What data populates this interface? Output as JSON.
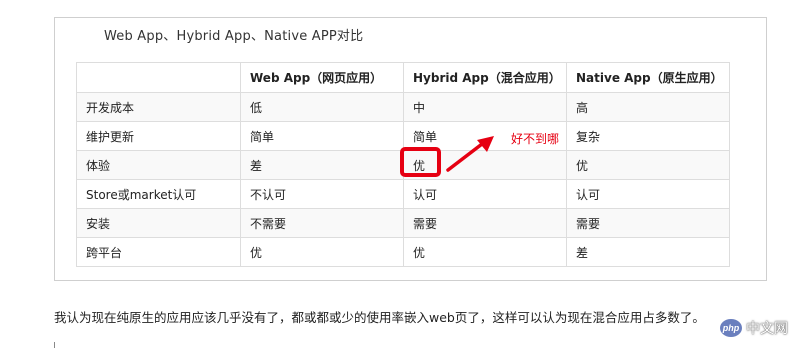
{
  "title": "Web App、Hybrid App、Native APP对比",
  "table": {
    "headers": [
      "",
      "Web App（网页应用）",
      "Hybrid App（混合应用）",
      "Native App（原生应用）"
    ],
    "rows": [
      [
        "开发成本",
        "低",
        "中",
        "高"
      ],
      [
        "维护更新",
        "简单",
        "简单",
        "复杂"
      ],
      [
        "体验",
        "差",
        "优",
        "优"
      ],
      [
        "Store或market认可",
        "不认可",
        "认可",
        "认可"
      ],
      [
        "安装",
        "不需要",
        "需要",
        "需要"
      ],
      [
        "跨平台",
        "优",
        "优",
        "差"
      ]
    ]
  },
  "annotation": "好不到哪",
  "annotation_color": "#e60012",
  "paragraph": "我认为现在纯原生的应用应该几乎没有了，都或都或少的使用率嵌入web页了，这样可以认为现在混合应用占多数了。",
  "watermark": {
    "logo": "php",
    "text": "中文网"
  }
}
